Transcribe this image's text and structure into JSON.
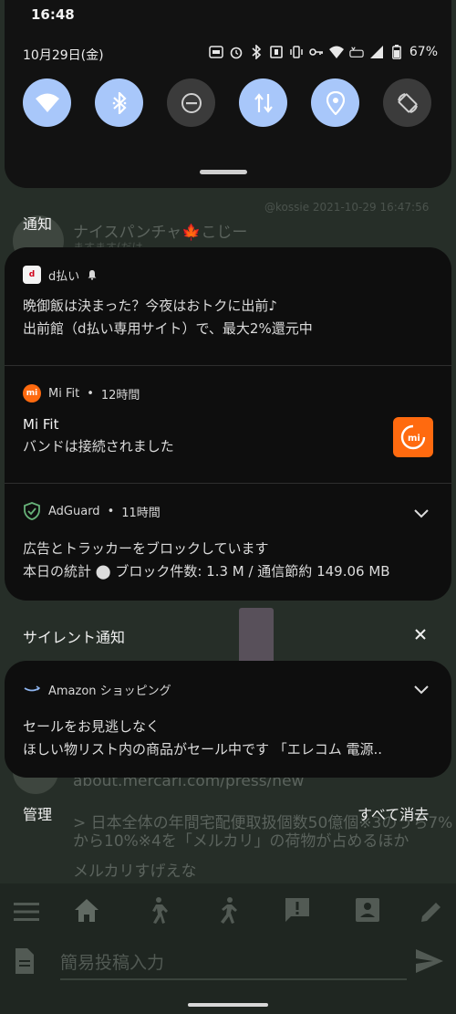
{
  "status_bar": {
    "time": "16:48",
    "date": "10月29日(金)",
    "battery": "67%",
    "icons": [
      "auto-icon",
      "alarm-icon",
      "bluetooth-icon",
      "nfc-icon",
      "vibrate-icon",
      "key-icon",
      "wifi-icon",
      "volte-icon",
      "signal-icon",
      "battery-icon"
    ]
  },
  "quick_settings": {
    "tiles": [
      {
        "name": "wifi",
        "state": "on"
      },
      {
        "name": "bluetooth",
        "state": "on"
      },
      {
        "name": "do-not-disturb",
        "state": "off"
      },
      {
        "name": "mobile-data",
        "state": "on"
      },
      {
        "name": "location",
        "state": "on"
      },
      {
        "name": "auto-rotate",
        "state": "off"
      }
    ]
  },
  "background_app": {
    "post_meta": "@kossie 2021-10-29 16:47:56",
    "username": "ナイスパンチャ🍁こじー",
    "subtitle": "ますます(だは...",
    "link": "about.mercari.com/press/new",
    "quote_line1": "> 日本全体の年間宅配便取扱個数50億個※3のうち7%",
    "quote_line2": "から10%※4を「メルカリ」の荷物が占めるほか",
    "comment": "メルカリすげえな",
    "input_placeholder": "簡易投稿入力"
  },
  "notifications": {
    "section_label": "通知",
    "items": [
      {
        "app": "d払い",
        "time": "",
        "title": "",
        "line1": "晩御飯は決まった？今夜はおトクに出前♪",
        "line2": "出前館（d払い専用サイト）で、最大2%還元中"
      },
      {
        "app": "Mi Fit",
        "time": "12時間",
        "title": "Mi Fit",
        "line1": "バンドは接続されました"
      },
      {
        "app": "AdGuard",
        "time": "11時間",
        "line1": "広告とトラッカーをブロックしています",
        "line2": "本日の統計 ⬤ ブロック件数: 1.3 M / 通信節約 149.06 MB"
      }
    ],
    "silent_label": "サイレント通知",
    "silent_items": [
      {
        "app": "Amazon ショッピング",
        "line1": "セールをお見逃しなく",
        "line2": "ほしい物リスト内の商品がセール中です 「エレコム 電源.."
      }
    ],
    "manage_label": "管理",
    "clear_all_label": "すべて消去"
  },
  "colors": {
    "tile_on": "#a8c7fa",
    "tile_off": "#3b3b3b",
    "panel": "#0e0e0e",
    "mi_orange": "#ff6a0f",
    "adguard_green": "#67b279"
  }
}
